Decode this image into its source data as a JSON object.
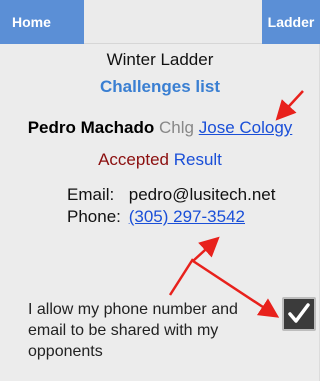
{
  "nav": {
    "home_label": "Home",
    "ladder_label": "Ladder"
  },
  "header": {
    "title": "Winter Ladder",
    "subtitle": "Challenges list"
  },
  "challenge": {
    "player": "Pedro Machado",
    "chlg_label": "Chlg",
    "opponent": "Jose Cology",
    "status": "Accepted",
    "result_label": "Result"
  },
  "contact": {
    "email_label": "Email:",
    "email": "pedro@lusitech.net",
    "phone_label": "Phone:",
    "phone": "(305) 297-3542"
  },
  "consent": {
    "text": "I allow my phone number and email to be shared with my opponents",
    "checked": true
  },
  "colors": {
    "nav_button": "#5b8fd6",
    "subtitle": "#3a7fd2",
    "link": "#1a4fd8",
    "accepted": "#8b0f0f",
    "annotation_arrow": "#e8211c"
  }
}
